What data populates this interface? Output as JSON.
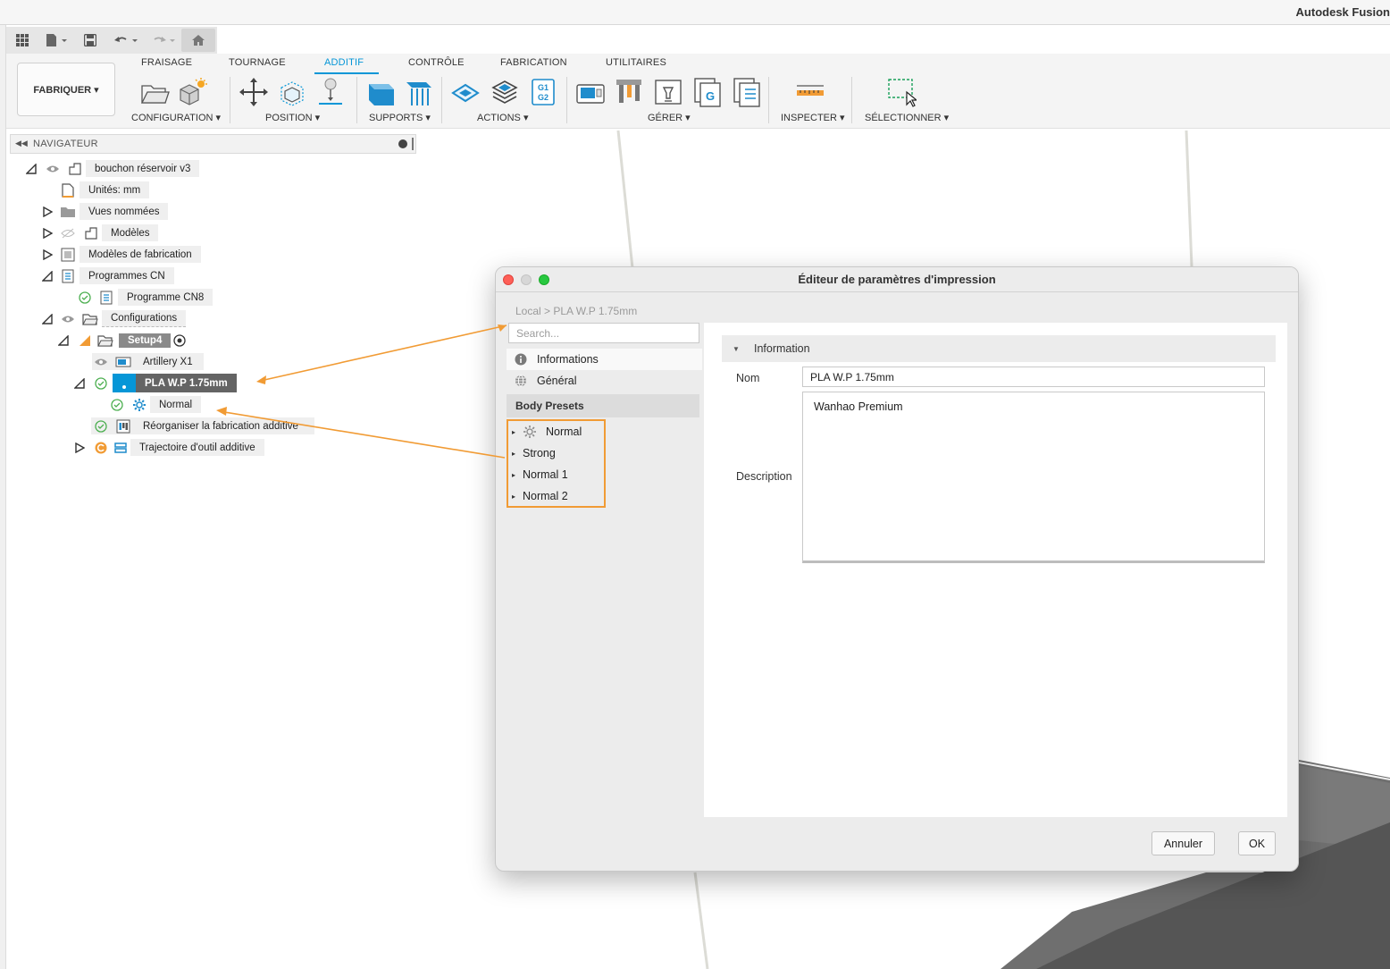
{
  "app": {
    "title": "Autodesk Fusion"
  },
  "qat": {
    "icons": [
      "grid-icon",
      "file-icon",
      "save-icon",
      "undo-icon",
      "redo-icon",
      "home-icon"
    ]
  },
  "ribbon": {
    "workspace": "FABRIQUER ▾",
    "tabs": [
      "FRAISAGE",
      "TOURNAGE",
      "ADDITIF",
      "CONTRÔLE",
      "FABRICATION",
      "UTILITAIRES"
    ],
    "active_tab": "ADDITIF",
    "groups": [
      "CONFIGURATION ▾",
      "POSITION ▾",
      "SUPPORTS ▾",
      "ACTIONS ▾",
      "GÉRER ▾",
      "INSPECTER ▾",
      "SÉLECTIONNER ▾"
    ],
    "accent": "#0696d7"
  },
  "navigator": {
    "title": "NAVIGATEUR",
    "items": [
      {
        "label": "bouchon réservoir v3"
      },
      {
        "label": "Unités: mm"
      },
      {
        "label": "Vues nommées"
      },
      {
        "label": "Modèles"
      },
      {
        "label": "Modèles de fabrication"
      },
      {
        "label": "Programmes CN"
      },
      {
        "label": "Programme CN8"
      },
      {
        "label": "Configurations"
      },
      {
        "label": "Setup4"
      },
      {
        "label": "Artillery X1"
      },
      {
        "label": "PLA W.P 1.75mm"
      },
      {
        "label": "Normal"
      },
      {
        "label": "Réorganiser la fabrication additive"
      },
      {
        "label": "Trajectoire d'outil additive"
      }
    ]
  },
  "dialog": {
    "title": "Éditeur de paramètres d'impression",
    "breadcrumb": "Local > PLA W.P 1.75mm",
    "search_placeholder": "Search...",
    "nav_items": [
      "Informations",
      "Général"
    ],
    "body_presets_header": "Body Presets",
    "presets": [
      "Normal",
      "Strong",
      "Normal 1",
      "Normal 2"
    ],
    "section_title": "Information",
    "name_label": "Nom",
    "name_value": "PLA W.P 1.75mm",
    "description_label": "Description",
    "description_value": "Wanhao Premium",
    "cancel_label": "Annuler",
    "ok_label": "OK",
    "highlight_color": "#f19b34"
  }
}
